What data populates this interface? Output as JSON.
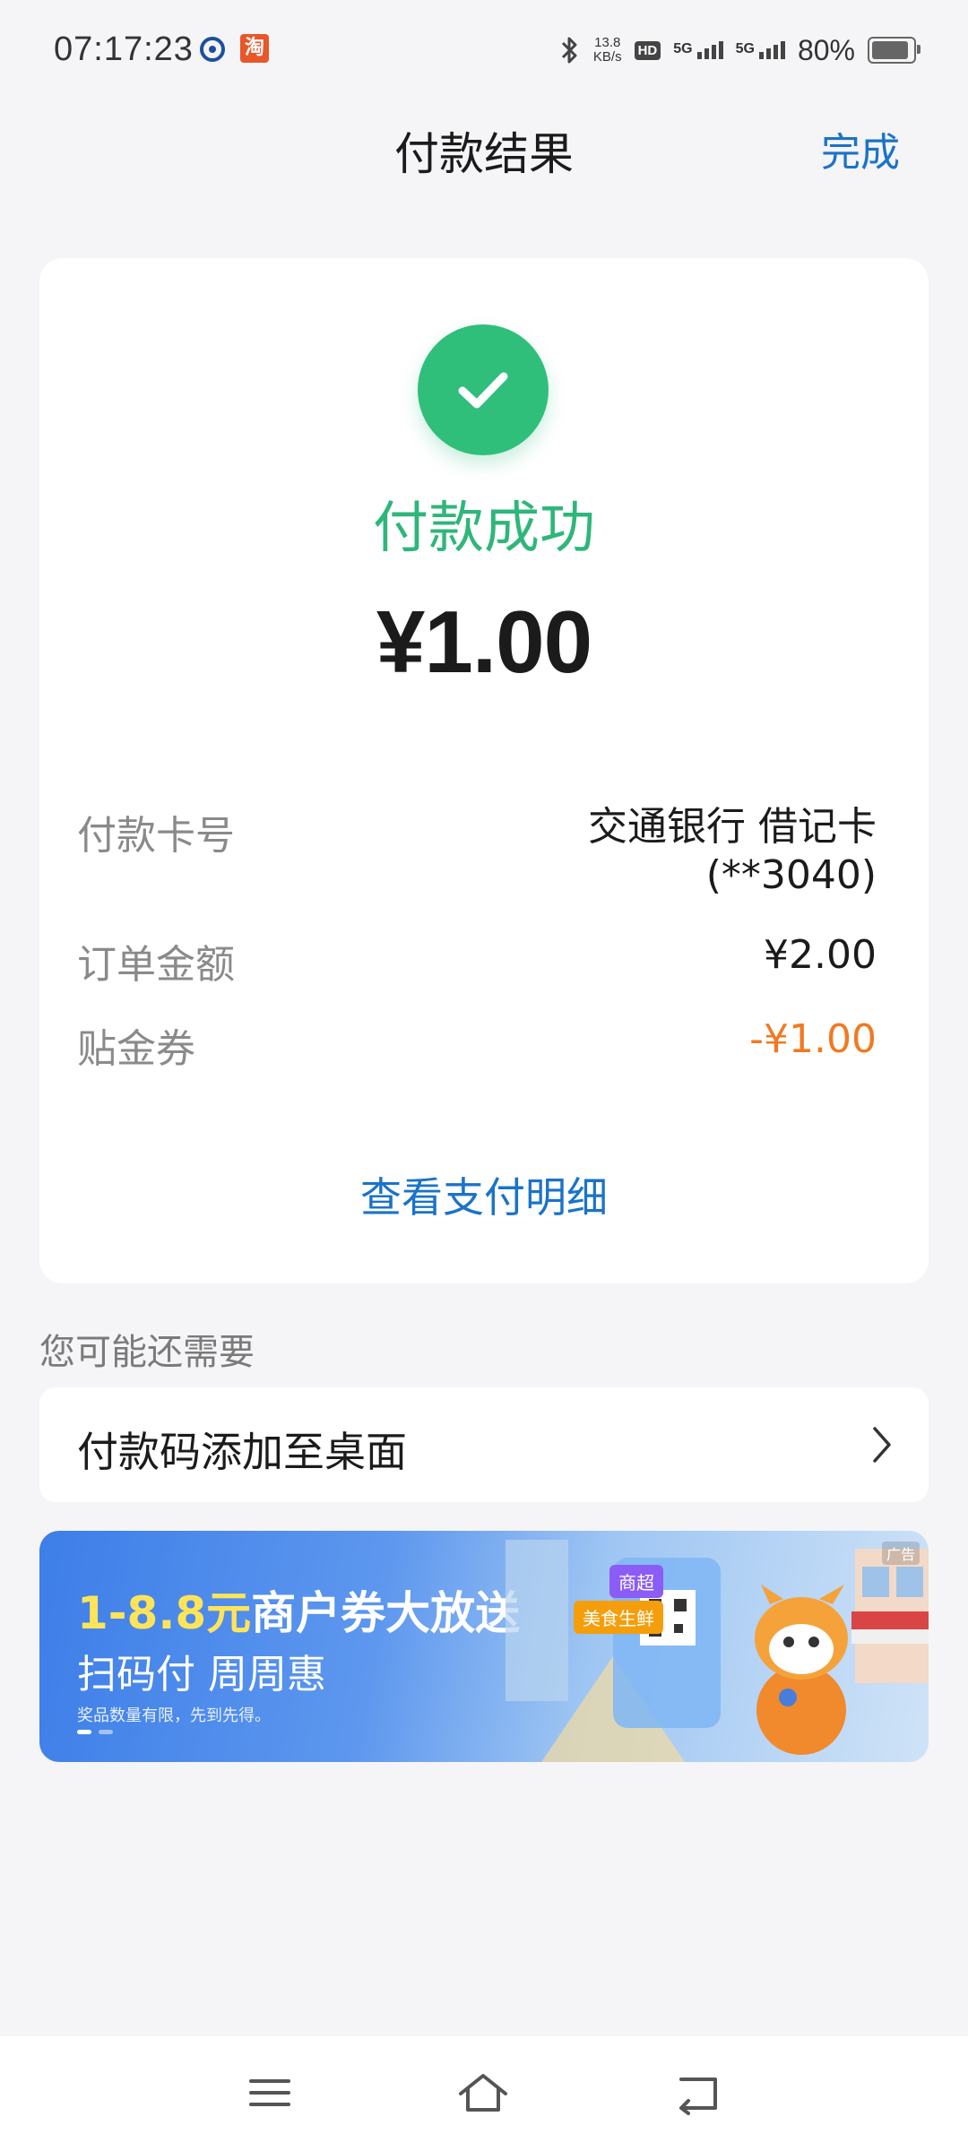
{
  "status_bar": {
    "time": "07:17:23",
    "app_icon_2": "淘",
    "net_speed_value": "13.8",
    "net_speed_unit": "KB/s",
    "hd_label": "HD",
    "signal_1_label": "5G",
    "signal_2_label": "5G",
    "battery_text": "80%"
  },
  "header": {
    "title": "付款结果",
    "done_label": "完成"
  },
  "card": {
    "status_text": "付款成功",
    "amount": "¥1.00",
    "rows": [
      {
        "label": "付款卡号",
        "value": "交通银行 借记卡(**3040)"
      },
      {
        "label": "订单金额",
        "value": "¥2.00"
      },
      {
        "label": "贴金券",
        "value": "-¥1.00"
      }
    ],
    "detail_link": "查看支付明细"
  },
  "section": {
    "title": "您可能还需要",
    "add_to_desktop": "付款码添加至桌面"
  },
  "banner": {
    "title_highlight": "1-8.8元",
    "title_rest": "商户券大放送",
    "subtitle": "扫码付 周周惠",
    "note": "奖品数量有限，先到先得。",
    "tag_1": "商超",
    "tag_2": "美食生鲜",
    "ad_label": "广告"
  },
  "colors": {
    "accent_blue": "#1a73c8",
    "success_green": "#2fbf7a",
    "discount_orange": "#f07a22"
  }
}
